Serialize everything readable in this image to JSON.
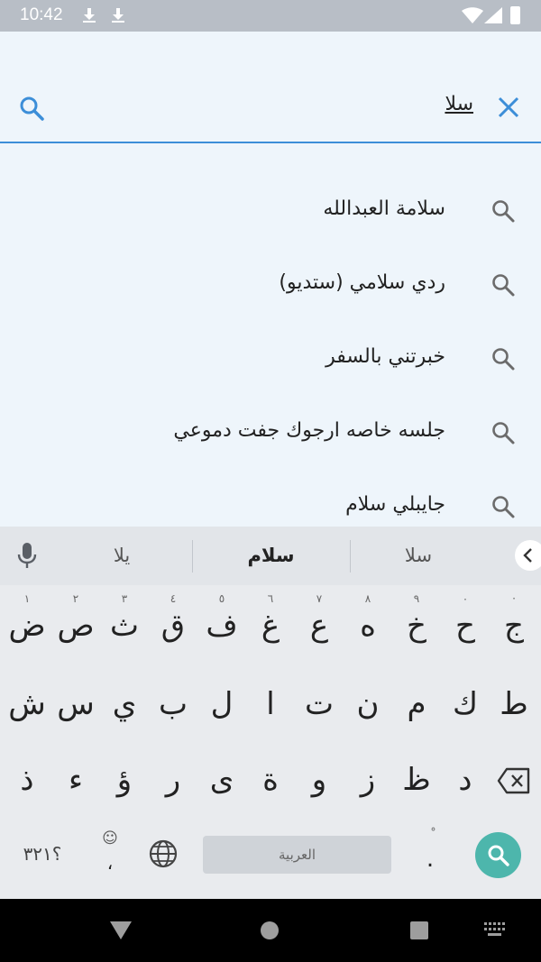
{
  "status_bar": {
    "time": "10:42"
  },
  "search": {
    "query": "سلا"
  },
  "suggestions": [
    {
      "text": "سلامة العبدالله"
    },
    {
      "text": "ردي سلامي (ستديو)"
    },
    {
      "text": "خبرتني بالسفر"
    },
    {
      "text": "جلسه خاصه ارجوك جفت دموعي"
    },
    {
      "text": "جايبلي سلام"
    }
  ],
  "keyboard": {
    "candidates": [
      "سلا",
      "سلام",
      "يلا"
    ],
    "row1": [
      {
        "key": "ج",
        "hint": "·"
      },
      {
        "key": "ح",
        "hint": "٠"
      },
      {
        "key": "خ",
        "hint": "٩"
      },
      {
        "key": "ه",
        "hint": "٨"
      },
      {
        "key": "ع",
        "hint": "٧"
      },
      {
        "key": "غ",
        "hint": "٦"
      },
      {
        "key": "ف",
        "hint": "٥"
      },
      {
        "key": "ق",
        "hint": "٤"
      },
      {
        "key": "ث",
        "hint": "٣"
      },
      {
        "key": "ص",
        "hint": "٢"
      },
      {
        "key": "ض",
        "hint": "١"
      }
    ],
    "row2": [
      "ط",
      "ك",
      "م",
      "ن",
      "ت",
      "ا",
      "ل",
      "ب",
      "ي",
      "س",
      "ش"
    ],
    "row3": [
      "د",
      "ظ",
      "ز",
      "و",
      "ة",
      "ى",
      "ر",
      "ؤ",
      "ء",
      "ذ"
    ],
    "symbols_label": "؟٣٢١",
    "comma_label": "،",
    "period_label": ".",
    "space_label": "العربية"
  }
}
